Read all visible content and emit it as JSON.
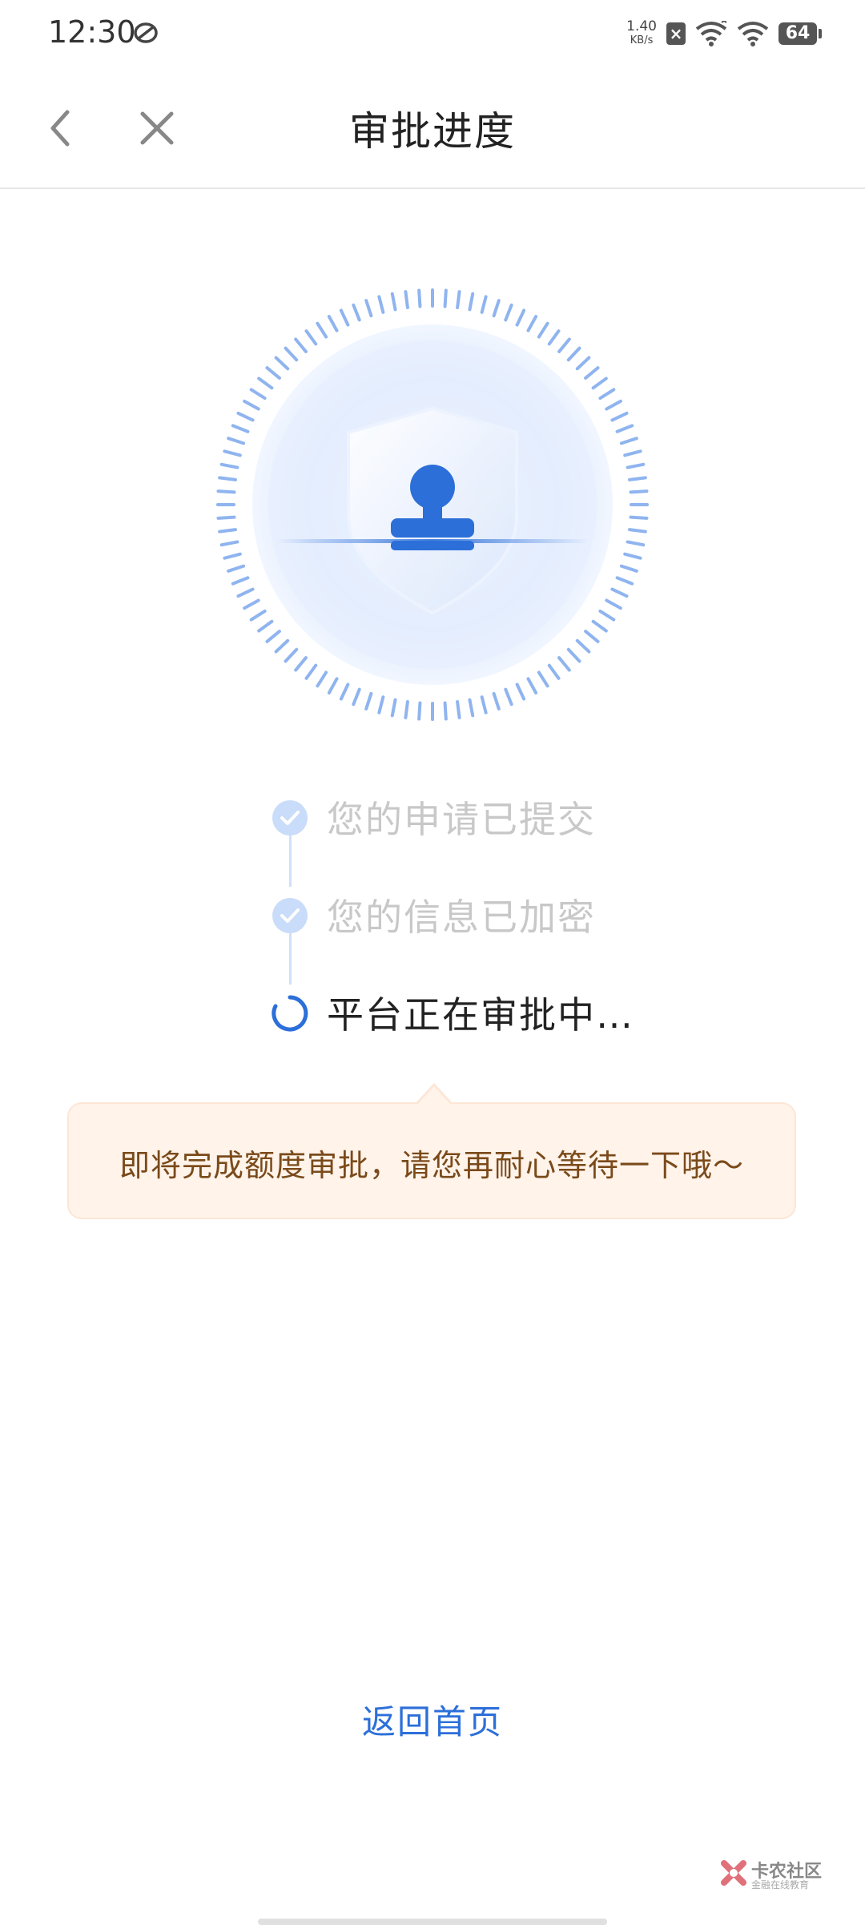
{
  "status_bar": {
    "time": "12:30",
    "net_speed_value": "1.40",
    "net_speed_unit": "KB/s",
    "battery_level": "64",
    "icons": [
      "sync-icon",
      "sim-icon",
      "wifi-signal-icon",
      "wifi-icon",
      "battery-icon"
    ]
  },
  "nav": {
    "title": "审批进度",
    "back_icon": "chevron-left-icon",
    "close_icon": "close-icon"
  },
  "illustration": {
    "icon": "shield-stamp-icon",
    "accent": "#2c6fd9"
  },
  "steps": [
    {
      "label": "您的申请已提交",
      "state": "done"
    },
    {
      "label": "您的信息已加密",
      "state": "done"
    },
    {
      "label": "平台正在审批中…",
      "state": "active"
    }
  ],
  "tip": {
    "text": "即将完成额度审批，请您再耐心等待一下哦～"
  },
  "home_link": "返回首页",
  "watermark": {
    "main": "卡农社区",
    "sub": "金融在线教育"
  },
  "colors": {
    "accent": "#2c6fd9",
    "done_check": "#c9dcf9",
    "tip_bg": "#fff3ea",
    "tip_text": "#7a4a1a"
  }
}
